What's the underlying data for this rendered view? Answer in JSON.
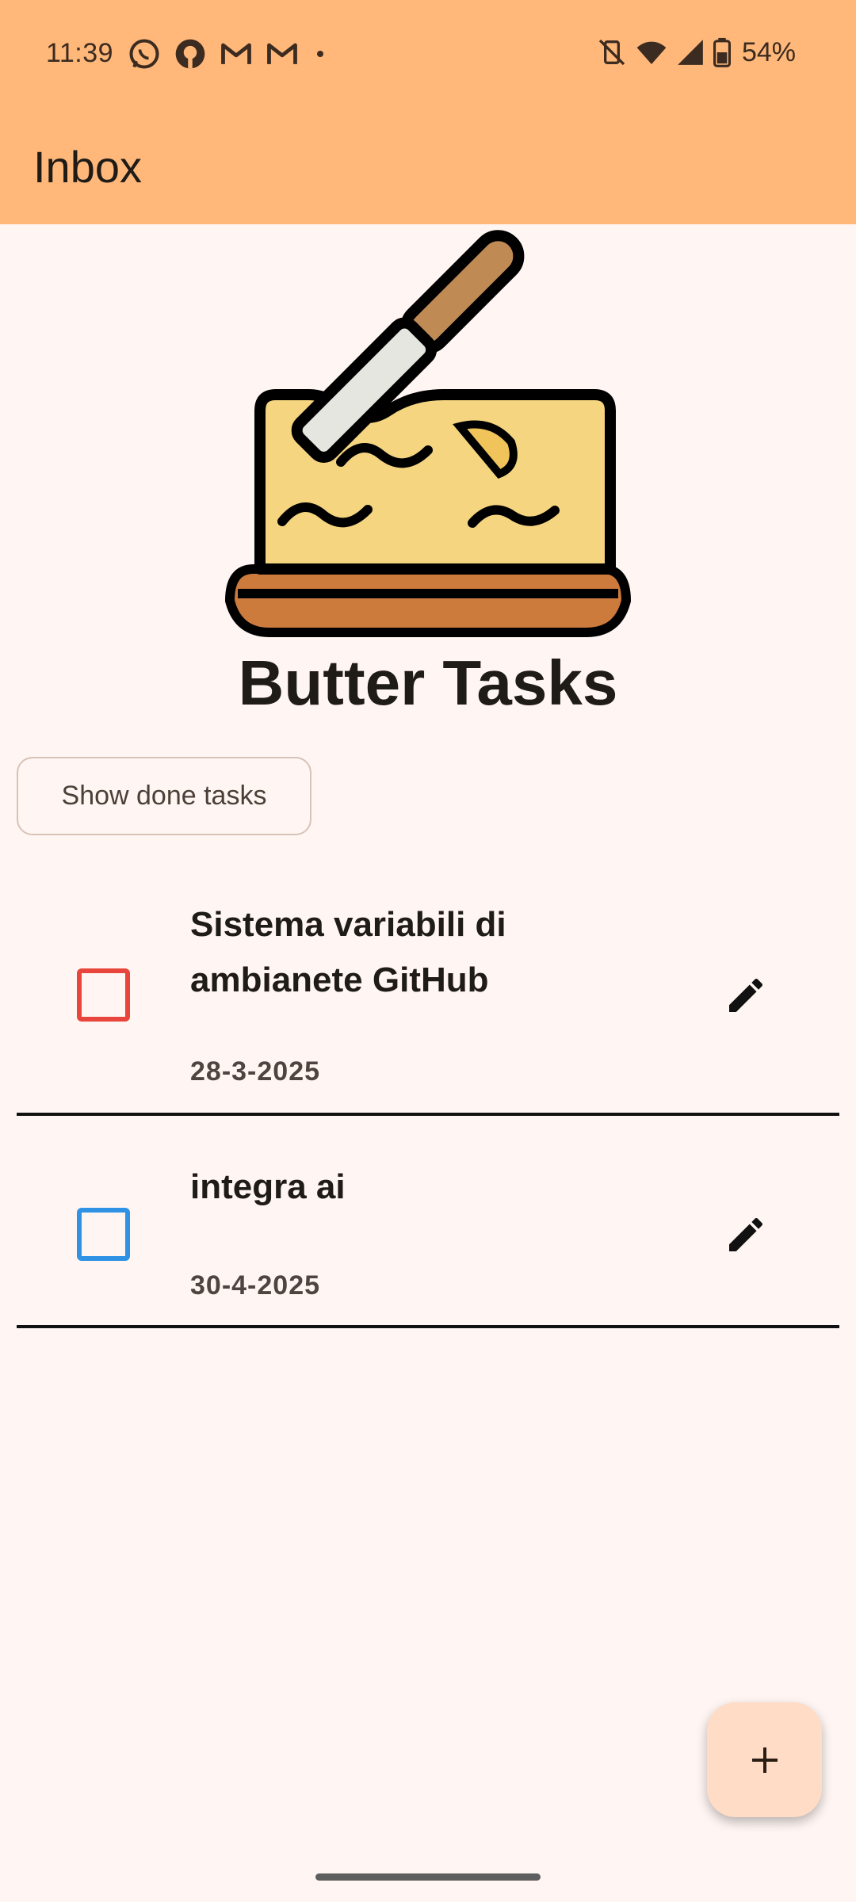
{
  "status": {
    "time": "11:39",
    "battery_percent": "54%",
    "notification_icons": [
      "whatsapp-icon",
      "github-icon",
      "gmail-icon",
      "gmail-icon",
      "dot-icon"
    ],
    "system_icons": [
      "vibrate-off-icon",
      "wifi-icon",
      "signal-icon",
      "battery-icon"
    ]
  },
  "appbar": {
    "title": "Inbox",
    "color": "#ffb87a"
  },
  "header": {
    "app_name": "Butter Tasks"
  },
  "actions": {
    "show_done_label": "Show done tasks"
  },
  "tasks": [
    {
      "title": "Sistema variabili di ambianete GitHub",
      "date": "28-3-2025",
      "checkbox_color": "#e8453c",
      "done": false
    },
    {
      "title": "integra ai",
      "date": "30-4-2025",
      "checkbox_color": "#2f92e5",
      "done": false
    }
  ],
  "fab": {
    "icon": "plus-icon",
    "color": "#ffdcc6"
  }
}
